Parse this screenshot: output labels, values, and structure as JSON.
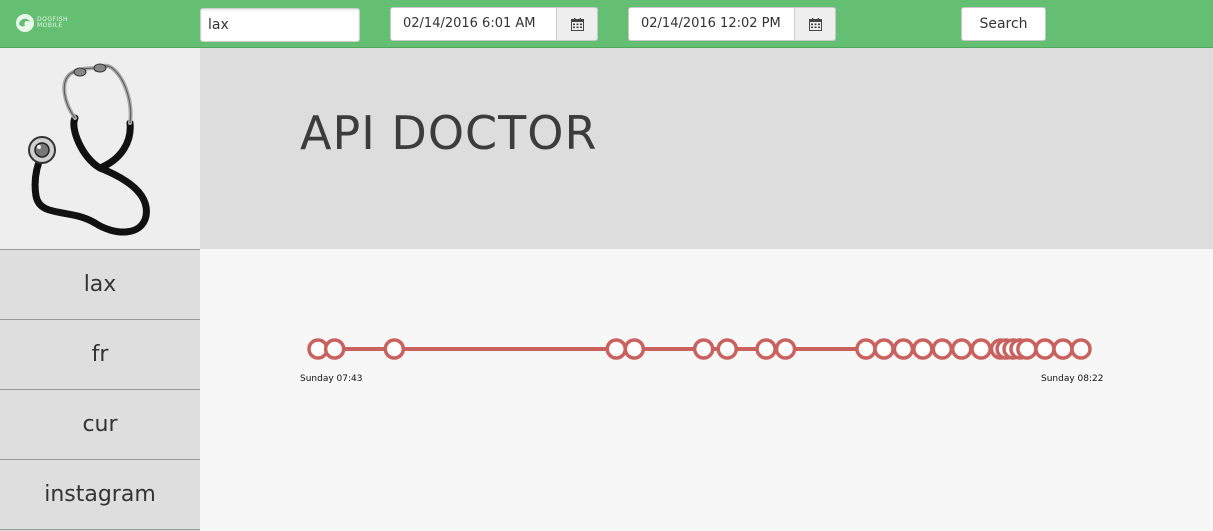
{
  "topbar": {
    "logo_text_line1": "DOGFISH",
    "logo_text_line2": "MOBILE",
    "search_value": "lax",
    "date_from": "02/14/2016 6:01 AM",
    "date_to": "02/14/2016 12:02 PM",
    "search_button": "Search",
    "calendar_icon": "calendar-icon"
  },
  "sidebar": {
    "logo_icon": "stethoscope-icon",
    "items": [
      {
        "label": "lax"
      },
      {
        "label": "fr"
      },
      {
        "label": "cur"
      },
      {
        "label": "instagram"
      }
    ]
  },
  "header": {
    "title": "API DOCTOR"
  },
  "timeline": {
    "start_label": "Sunday 07:43",
    "end_label": "Sunday 08:22",
    "events_minutes_from_start": [
      0.0,
      1.2,
      5.5,
      21.5,
      22.8,
      27.8,
      29.5,
      32.3,
      33.7,
      39.5,
      40.8,
      42.2,
      43.6,
      45.0,
      46.4,
      47.8,
      49.2,
      49.6,
      50.1,
      50.6,
      51.1,
      52.4,
      53.7,
      55.0
    ],
    "event_marker_color": "#c9625f",
    "line_color": "#c9625f"
  }
}
